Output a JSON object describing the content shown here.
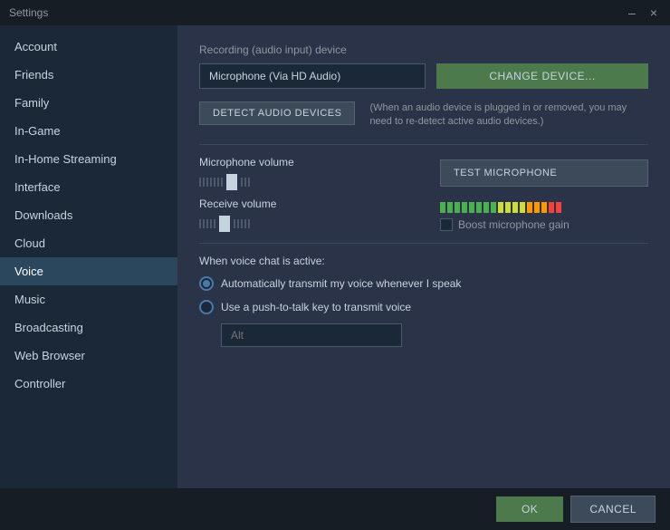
{
  "window": {
    "title": "Settings",
    "close_label": "×",
    "minimize_label": "–"
  },
  "sidebar": {
    "items": [
      {
        "id": "account",
        "label": "Account",
        "active": false
      },
      {
        "id": "friends",
        "label": "Friends",
        "active": false
      },
      {
        "id": "family",
        "label": "Family",
        "active": false
      },
      {
        "id": "in-game",
        "label": "In-Game",
        "active": false
      },
      {
        "id": "in-home-streaming",
        "label": "In-Home Streaming",
        "active": false
      },
      {
        "id": "interface",
        "label": "Interface",
        "active": false
      },
      {
        "id": "downloads",
        "label": "Downloads",
        "active": false
      },
      {
        "id": "cloud",
        "label": "Cloud",
        "active": false
      },
      {
        "id": "voice",
        "label": "Voice",
        "active": true
      },
      {
        "id": "music",
        "label": "Music",
        "active": false
      },
      {
        "id": "broadcasting",
        "label": "Broadcasting",
        "active": false
      },
      {
        "id": "web-browser",
        "label": "Web Browser",
        "active": false
      },
      {
        "id": "controller",
        "label": "Controller",
        "active": false
      }
    ]
  },
  "main": {
    "recording_label": "Recording (audio input) device",
    "device_name": "Microphone (Via HD Audio)",
    "change_device_btn": "CHANGE DEVICE...",
    "detect_btn": "DETECT AUDIO DEVICES",
    "detect_note": "(When an audio device is plugged in or removed, you may need to re-detect active audio devices.)",
    "microphone_volume_label": "Microphone volume",
    "test_mic_btn": "TEST MICROPHONE",
    "receive_volume_label": "Receive volume",
    "boost_mic_label": "Boost microphone gain",
    "voice_active_label": "When voice chat is active:",
    "radio1_label": "Automatically transmit my voice whenever I speak",
    "radio2_label": "Use a push-to-talk key to transmit voice",
    "push_key_placeholder": "Alt"
  },
  "footer": {
    "ok_label": "OK",
    "cancel_label": "CANCEL"
  }
}
